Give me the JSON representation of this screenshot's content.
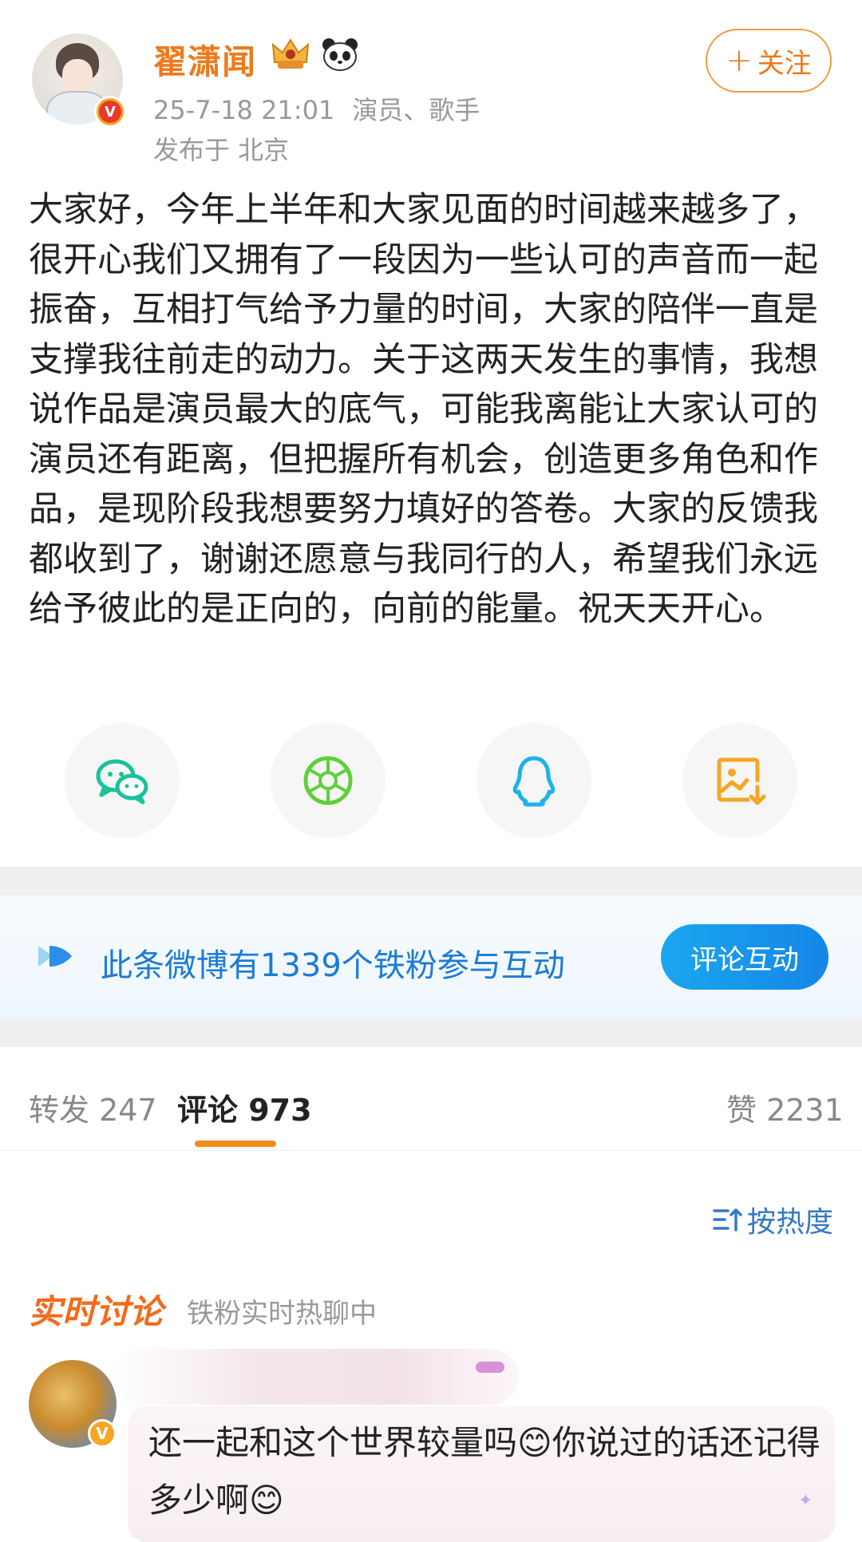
{
  "post": {
    "username": "翟潇闻",
    "time": "25-7-18 21:01",
    "role": "演员、歌手",
    "location": "发布于 北京",
    "follow_label": "关注",
    "text": "大家好，今年上半年和大家见面的时间越来越多了，很开心我们又拥有了一段因为一些认可的声音而一起振奋，互相打气给予力量的时间，大家的陪伴一直是支撑我往前走的动力。关于这两天发生的事情，我想说作品是演员最大的底气，可能我离能让大家认可的演员还有距离，但把握所有机会，创造更多角色和作品，是现阶段我想要努力填好的答卷。大家的反馈我都收到了，谢谢还愿意与我同行的人，希望我们永远给予彼此的是正向的，向前的能量。祝天天开心。"
  },
  "share": {
    "items": [
      "wechat-icon",
      "moments-icon",
      "qq-icon",
      "save-image-icon"
    ]
  },
  "fans_banner": {
    "text": "此条微博有1339个铁粉参与互动",
    "button_label": "评论互动"
  },
  "tabs": {
    "repost": "转发 247",
    "comments": "评论 973",
    "likes": "赞 2231"
  },
  "sort": {
    "label": "按热度"
  },
  "live": {
    "title": "实时讨论",
    "subtitle": "铁粉实时热聊中"
  },
  "comment": {
    "text": "还一起和这个世界较量吗😊你说过的话还记得多少啊😊"
  },
  "colors": {
    "accent_orange": "#ee7a1c",
    "link_blue": "#1a7bd6",
    "button_blue": "#1586e6"
  }
}
